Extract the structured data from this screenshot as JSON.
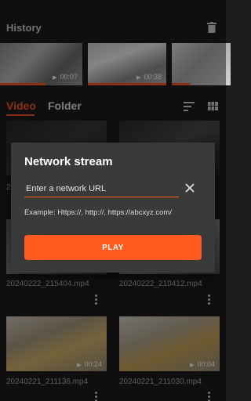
{
  "colors": {
    "accent": "#ff5a1f",
    "background": "#1c1c1c",
    "dialog": "#3a3a3a"
  },
  "history": {
    "title": "History",
    "delete_icon": "trash-icon",
    "items": [
      {
        "duration": ""
      },
      {
        "duration": "00:07"
      },
      {
        "duration": "00:38"
      },
      {
        "duration": ""
      }
    ]
  },
  "tabs": {
    "video": "Video",
    "folder": "Folder"
  },
  "toolbar": {
    "sort_icon": "sort-icon",
    "view_icon": "grid-view-icon"
  },
  "videos": [
    {
      "name": "20240222_215404.mp4",
      "duration": ""
    },
    {
      "name": "20240222_210412.mp4",
      "duration": ""
    },
    {
      "name": "20240221_211136.mp4",
      "duration": "00:24"
    },
    {
      "name": "20240221_211030.mp4",
      "duration": "00:04"
    }
  ],
  "background_fragment": "2",
  "dialog": {
    "title": "Network stream",
    "placeholder": "Enter a network URL",
    "example": "Example: Https://, http://, https://abcxyz.com/",
    "play_label": "PLAY"
  }
}
